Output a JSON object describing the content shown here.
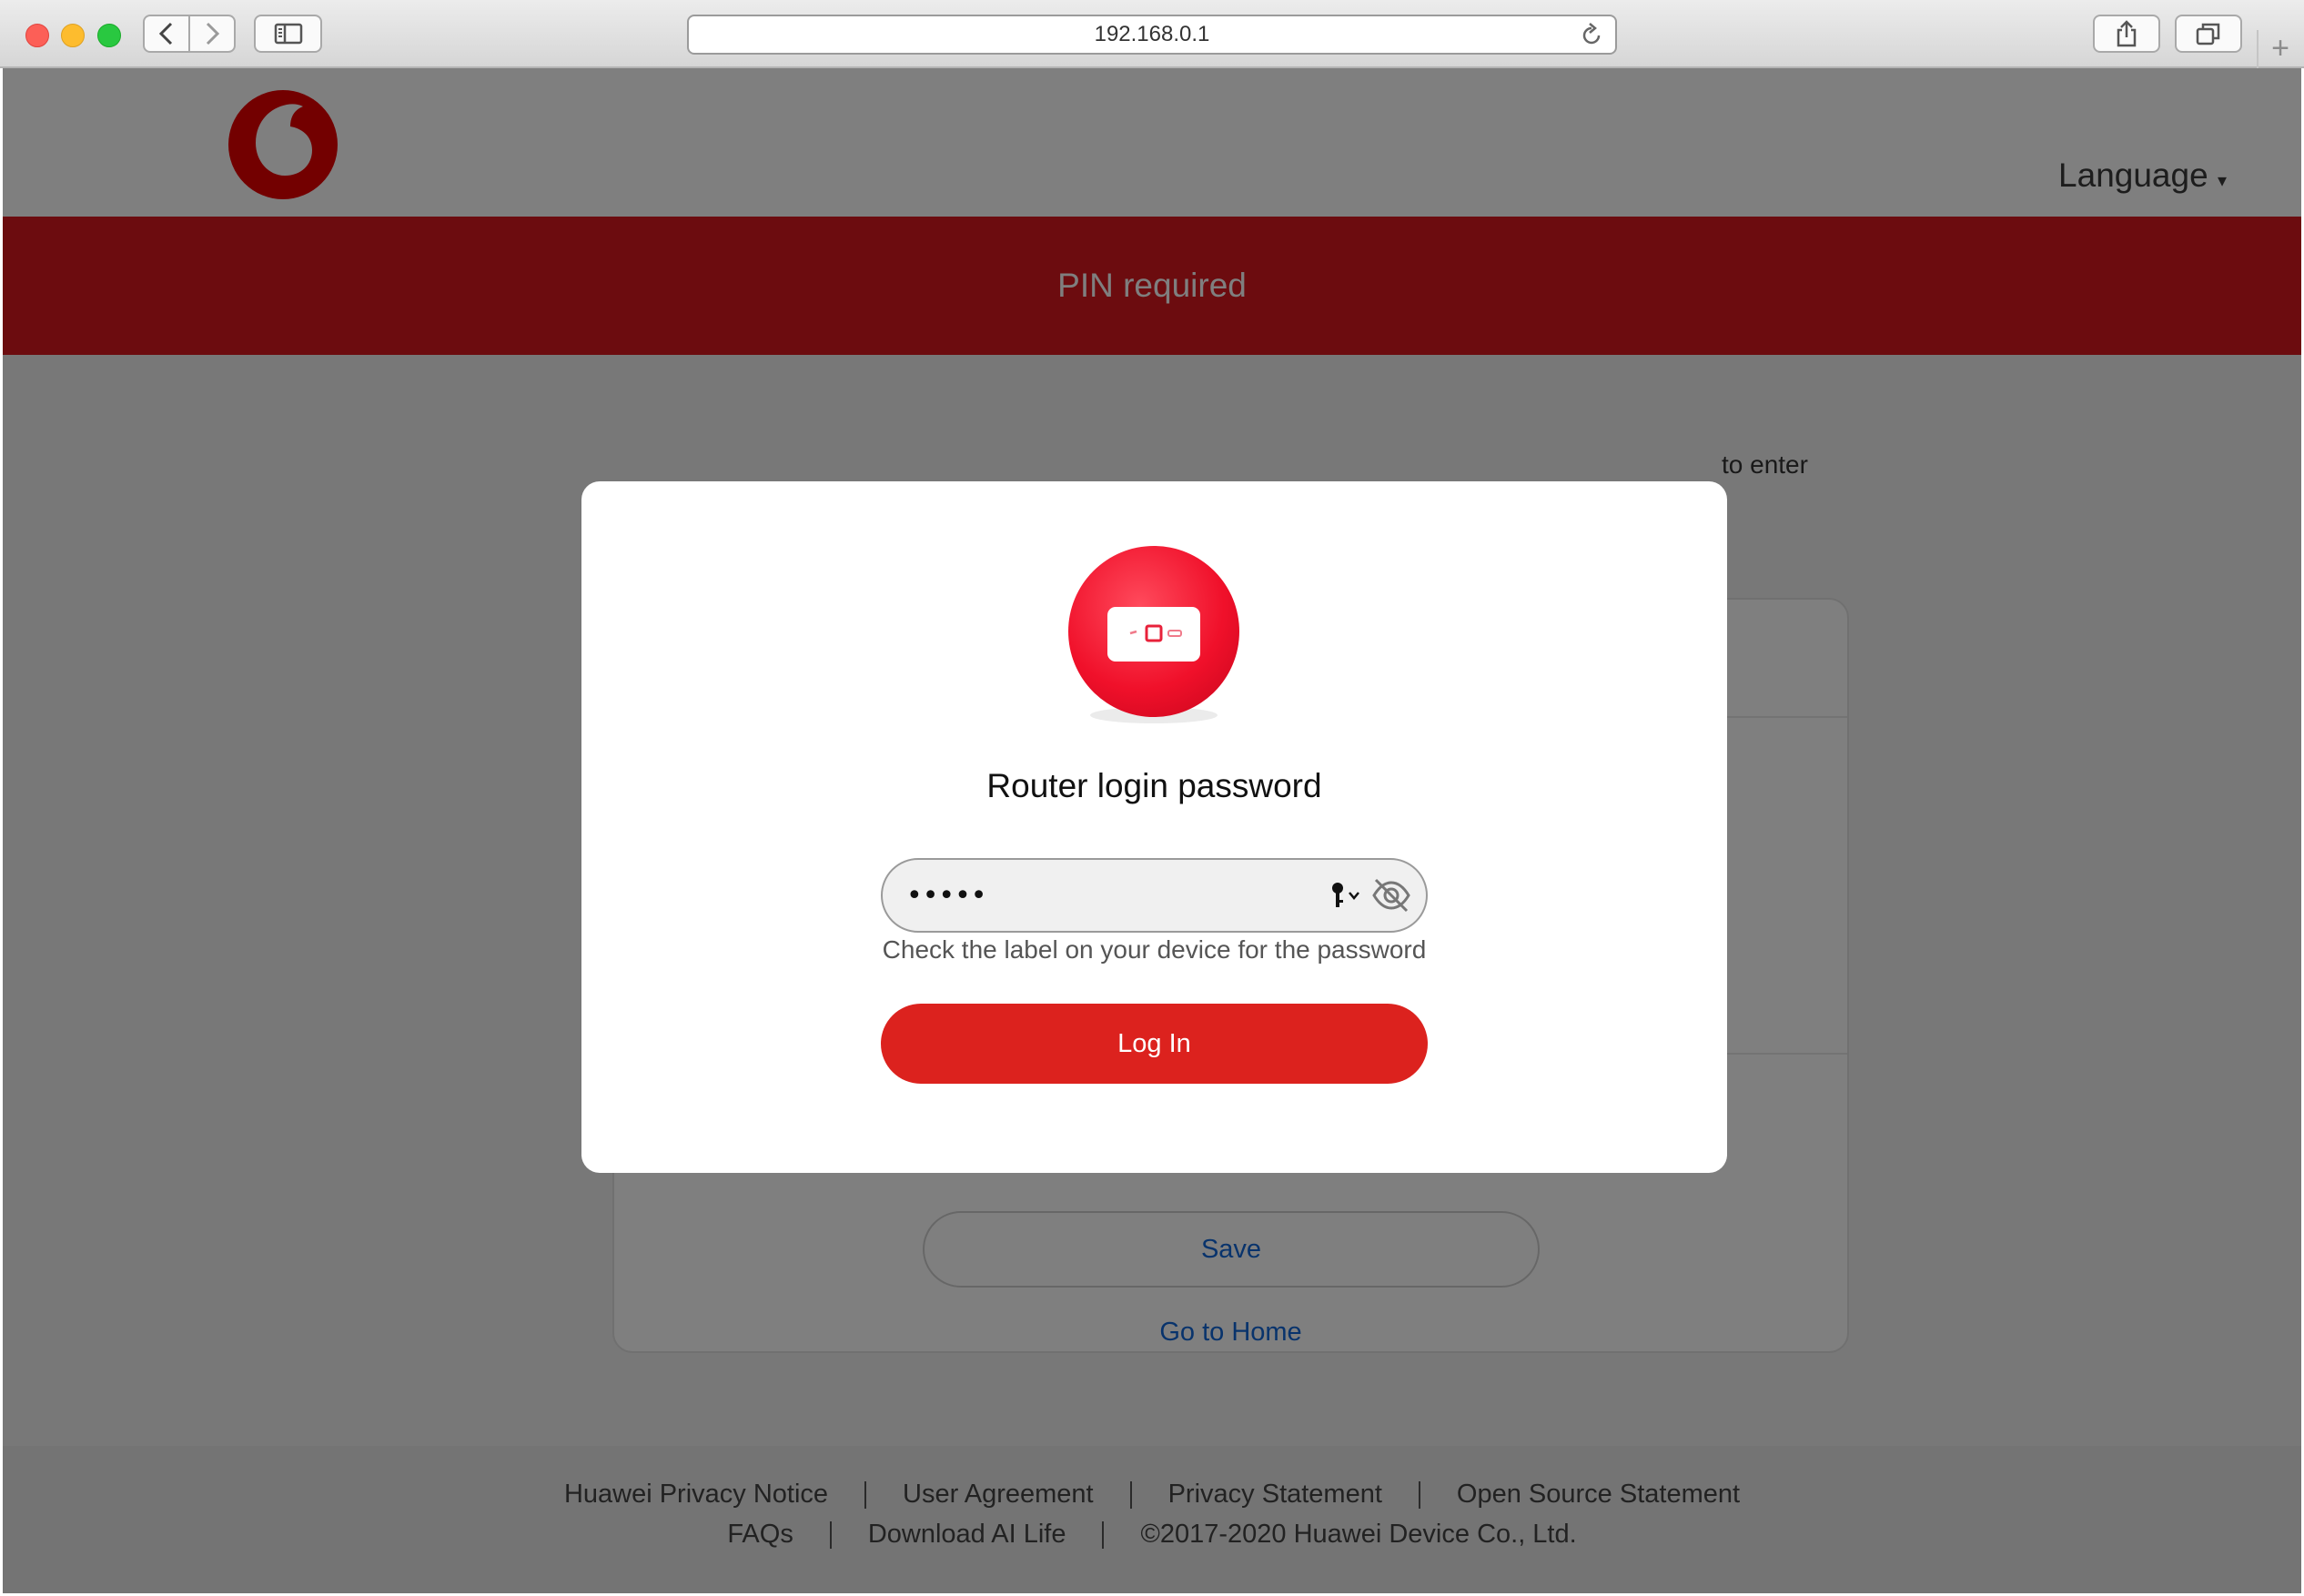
{
  "browser": {
    "url": "192.168.0.1"
  },
  "header": {
    "language_label": "Language"
  },
  "banner": {
    "title": "PIN required"
  },
  "background_page": {
    "partial_text": "to enter",
    "save_label": "Save",
    "home_label": "Go to Home"
  },
  "modal": {
    "title": "Router login password",
    "password_value": "•••••",
    "hint": "Check the label on your device for the password",
    "login_label": "Log In"
  },
  "footer": {
    "row1": [
      "Huawei Privacy Notice",
      "User Agreement",
      "Privacy Statement",
      "Open Source Statement"
    ],
    "row2": [
      "FAQs",
      "Download AI Life",
      "©2017-2020 Huawei Device Co., Ltd."
    ]
  },
  "colors": {
    "brand_red": "#d9181f",
    "button_red": "#dc221e",
    "link_blue": "#1166d8"
  }
}
